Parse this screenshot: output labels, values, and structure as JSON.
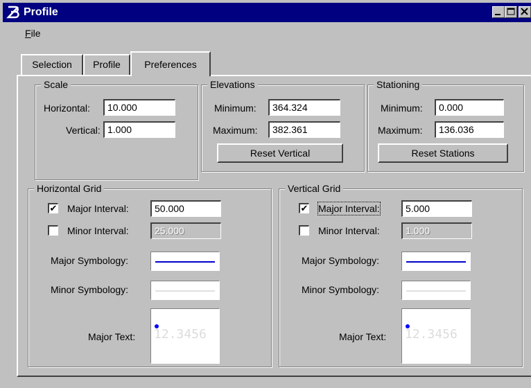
{
  "window": {
    "title": "Profile",
    "icon": "app-logo-icon"
  },
  "menu": {
    "file_prefix": "F",
    "file_rest": "ile"
  },
  "tabs": [
    {
      "label": "Selection",
      "active": false
    },
    {
      "label": "Profile",
      "active": false
    },
    {
      "label": "Preferences",
      "active": true
    }
  ],
  "scale": {
    "title": "Scale",
    "horizontal_label": "Horizontal:",
    "horizontal_value": "10.000",
    "vertical_label": "Vertical:",
    "vertical_value": "1.000"
  },
  "elevations": {
    "title": "Elevations",
    "minimum_label": "Minimum:",
    "minimum_value": "364.324",
    "maximum_label": "Maximum:",
    "maximum_value": "382.361",
    "reset_label": "Reset Vertical"
  },
  "stationing": {
    "title": "Stationing",
    "minimum_label": "Minimum:",
    "minimum_value": "0.000",
    "maximum_label": "Maximum:",
    "maximum_value": "136.036",
    "reset_label": "Reset Stations"
  },
  "horizontal_grid": {
    "title": "Horizontal Grid",
    "major_interval_label": "Major Interval:",
    "major_interval_value": "50.000",
    "major_checked": true,
    "minor_interval_label": "Minor Interval:",
    "minor_interval_value": "25.000",
    "minor_checked": false,
    "major_symbology_label": "Major Symbology:",
    "minor_symbology_label": "Minor Symbology:",
    "major_text_label": "Major Text:",
    "major_text_sample": "12.3456"
  },
  "vertical_grid": {
    "title": "Vertical Grid",
    "major_interval_label": "Major Interval:",
    "major_interval_value": "5.000",
    "major_checked": true,
    "minor_interval_label": "Minor Interval:",
    "minor_interval_value": "1.000",
    "minor_checked": false,
    "major_symbology_label": "Major Symbology:",
    "minor_symbology_label": "Minor Symbology:",
    "major_text_label": "Major Text:",
    "major_text_sample": "12.3456"
  },
  "colors": {
    "title_bar": "#000080",
    "major_line": "#0000cc",
    "minor_line": "#e0e0e0",
    "text_dot": "#0000ff"
  },
  "check_glyph": "✔"
}
